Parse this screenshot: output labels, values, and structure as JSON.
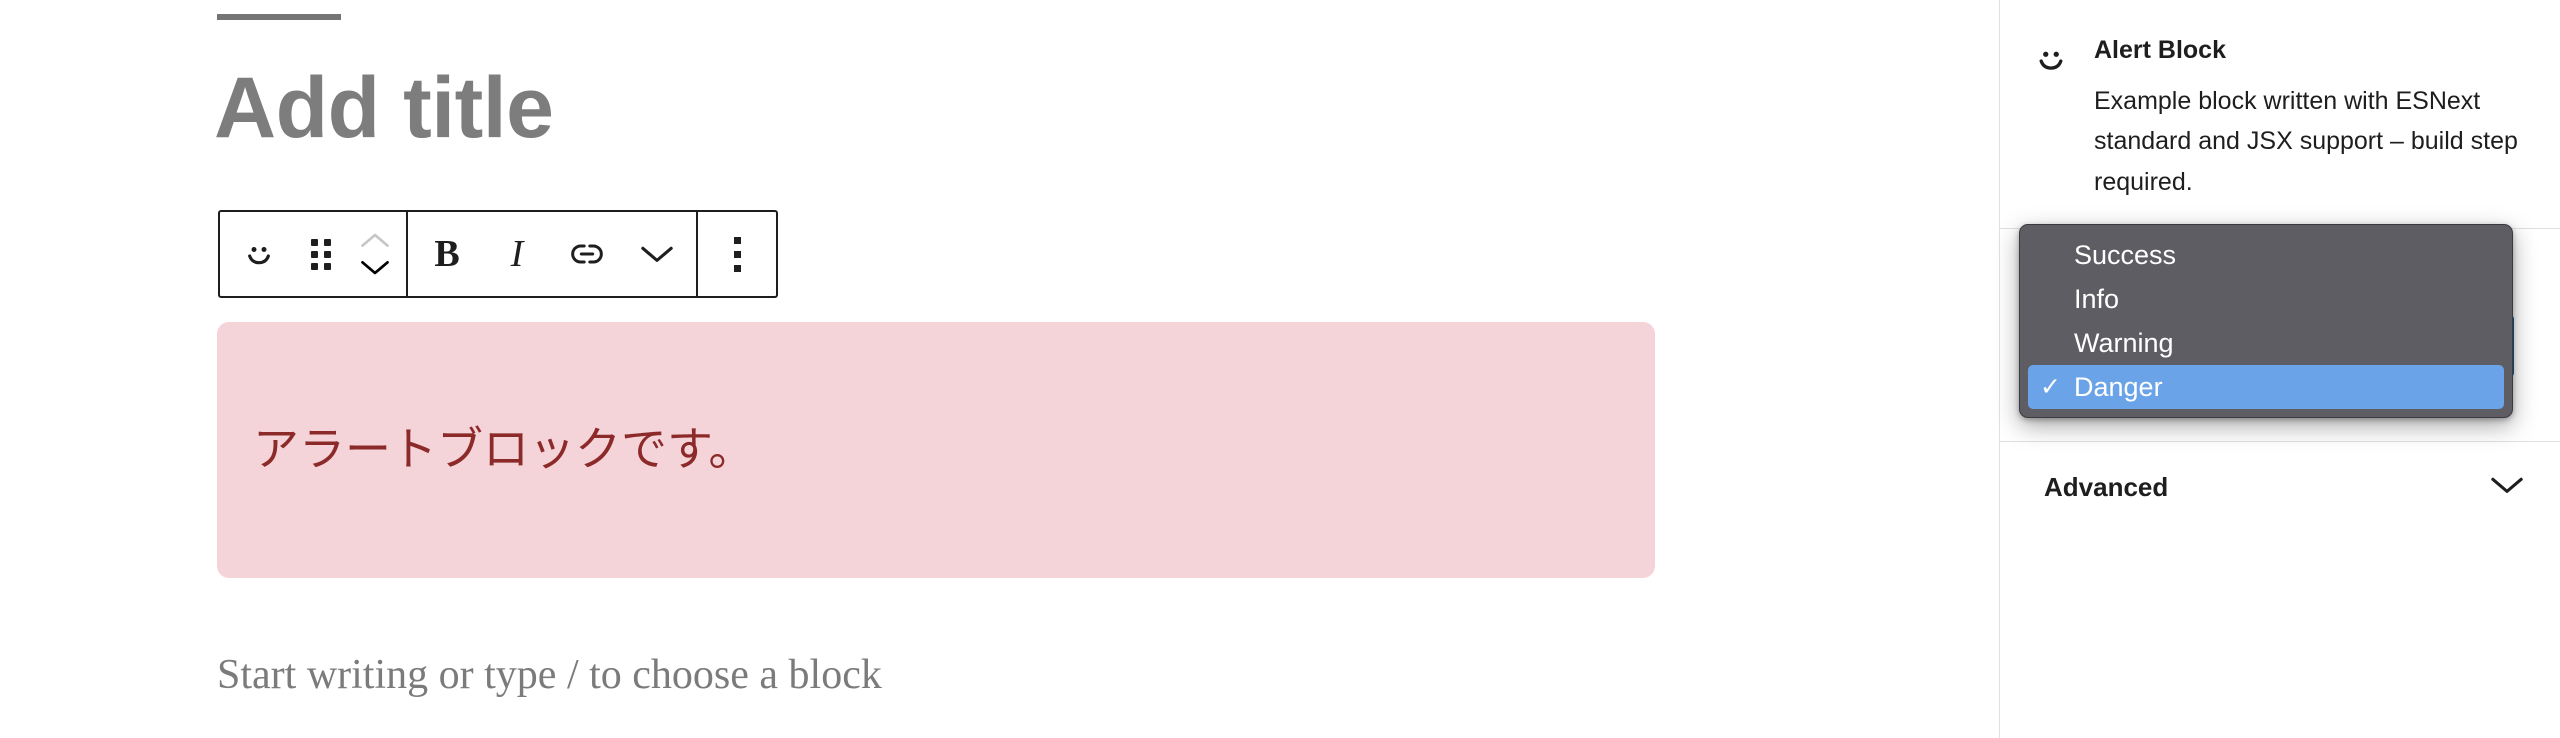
{
  "editor": {
    "title_placeholder": "Add title",
    "paragraph_placeholder": "Start writing or type / to choose a block",
    "alert_block": {
      "text": "アラートブロックです。",
      "background_color": "#f4d4d8",
      "text_color": "#8c2a2a"
    },
    "toolbar": {
      "block_type_icon": "smiley-icon",
      "drag_handle_icon": "drag-handle-icon",
      "move_up_icon": "chevron-up-icon",
      "move_down_icon": "chevron-down-icon",
      "bold_label": "B",
      "italic_label": "I",
      "link_icon": "link-icon",
      "more_formatting_icon": "chevron-down-icon",
      "options_icon": "more-options-vertical-icon"
    }
  },
  "sidebar": {
    "block_card": {
      "icon": "smiley-icon",
      "title": "Alert Block",
      "description": "Example block written with ESNext standard and JSX support – build step required."
    },
    "alert_type": {
      "selected": "Danger",
      "hint_glyph": "▾"
    },
    "advanced": {
      "label": "Advanced",
      "chevron_icon": "chevron-down-icon"
    }
  },
  "select_popup": {
    "checkmark": "✓",
    "options": [
      {
        "label": "Success",
        "selected": false
      },
      {
        "label": "Info",
        "selected": false
      },
      {
        "label": "Warning",
        "selected": false
      },
      {
        "label": "Danger",
        "selected": true
      }
    ],
    "background_color": "#5e5d63",
    "highlight_color": "#6ba3e8"
  }
}
